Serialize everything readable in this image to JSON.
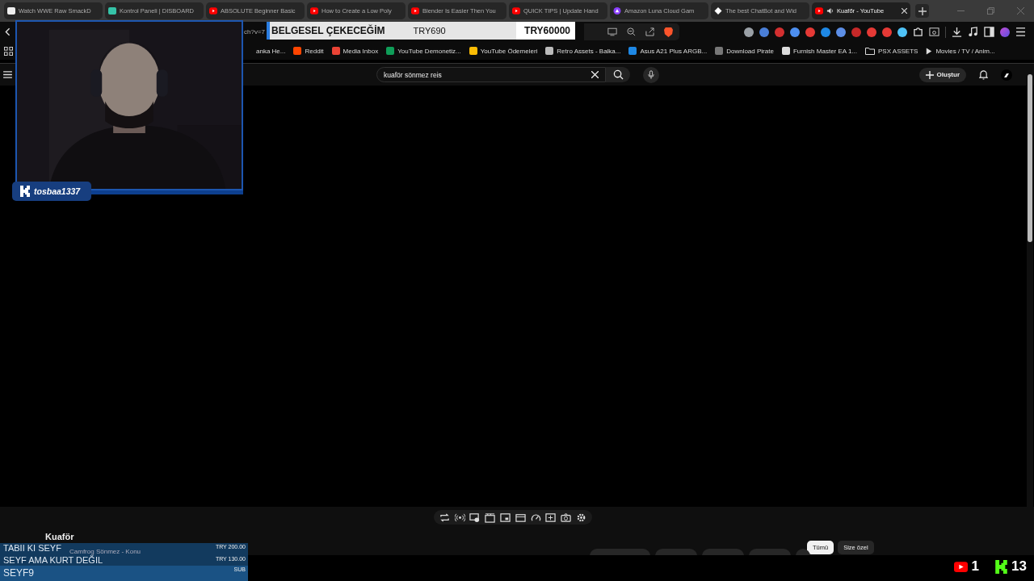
{
  "browser": {
    "tabs": [
      {
        "title": "Watch WWE Raw SmackD",
        "kind": "page",
        "audio": false,
        "selected": false
      },
      {
        "title": "Kontrol Paneli | DISBOARD",
        "kind": "board",
        "audio": false,
        "selected": false
      },
      {
        "title": "ABSOLUTE Beginner Basic",
        "kind": "youtube",
        "audio": false,
        "selected": false
      },
      {
        "title": "How to Create a Low Poly",
        "kind": "youtube",
        "audio": false,
        "selected": false
      },
      {
        "title": "Blender Is Easier Then You",
        "kind": "youtube",
        "audio": false,
        "selected": false
      },
      {
        "title": "QUICK TIPS | Update Hand",
        "kind": "youtube",
        "audio": false,
        "selected": false
      },
      {
        "title": "Amazon Luna Cloud Gam",
        "kind": "luna",
        "audio": false,
        "selected": false
      },
      {
        "title": "The best ChatBot and Wid",
        "kind": "diamond",
        "audio": false,
        "selected": false
      },
      {
        "title": "Kuafőr - YouTube",
        "kind": "youtube",
        "audio": true,
        "selected": true
      }
    ],
    "url_fragment": "ch?v=7",
    "extensions": [
      {
        "color": "#9aa0a6"
      },
      {
        "color": "#4a7fd8"
      },
      {
        "color": "#d32f2f"
      },
      {
        "color": "#4d8ff0"
      },
      {
        "color": "#e53935"
      },
      {
        "color": "#1e88e5"
      },
      {
        "color": "#5c8ee6"
      },
      {
        "color": "#c62828"
      },
      {
        "color": "#e53935"
      },
      {
        "color": "#e53935"
      },
      {
        "color": "#4fc3f7"
      }
    ],
    "bookmarks": [
      {
        "label": "anka He...",
        "kind": "none"
      },
      {
        "label": "Reddit",
        "kind": "reddit"
      },
      {
        "label": "Media Inbox",
        "kind": "mail"
      },
      {
        "label": "YouTube Demonetiz...",
        "kind": "sheet"
      },
      {
        "label": "YouTube Ödemeleri",
        "kind": "drive"
      },
      {
        "label": "Retro Assets - Balka...",
        "kind": "box"
      },
      {
        "label": "Asus A21 Plus ARGB...",
        "kind": "check"
      },
      {
        "label": "Download Pirate",
        "kind": "letter"
      },
      {
        "label": "Furnish Master EA 1...",
        "kind": "notion"
      },
      {
        "label": "PSX ASSETS",
        "kind": "folder"
      },
      {
        "label": "Movies / TV / Anim...",
        "kind": "play"
      }
    ]
  },
  "youtube": {
    "search": {
      "value": "kuaför sönmez reis"
    },
    "create_label": "Oluştur",
    "player_controls": [
      {
        "kind": "loop"
      },
      {
        "kind": "broadcast"
      },
      {
        "kind": "cast"
      },
      {
        "kind": "clapper"
      },
      {
        "kind": "pip"
      },
      {
        "kind": "window"
      },
      {
        "kind": "speed"
      },
      {
        "kind": "add"
      },
      {
        "kind": "camera"
      },
      {
        "kind": "gear"
      }
    ],
    "video_title": "Kuaför",
    "channel_name": "Camfrog Sönmez - Konu",
    "chips": [
      {
        "label": "Tümü",
        "selected": true
      },
      {
        "label": "Size özel",
        "selected": false
      }
    ]
  },
  "stream_overlay": {
    "username": "tosbaa1337",
    "title_bar": {
      "heading": "BELGESEL ÇEKECEĞİM",
      "goal": "TRY690",
      "target": "TRY60000"
    },
    "donations": [
      {
        "name": "TABII KI SEYF",
        "amount": "TRY 200.00"
      },
      {
        "name": "SEYF AMA KURT DEĞIL",
        "amount": "TRY 130.00"
      },
      {
        "name": "SEYF9",
        "amount": "SUB"
      }
    ],
    "counters": [
      {
        "kind": "youtube",
        "count": "1"
      },
      {
        "kind": "kick",
        "count": "13"
      }
    ]
  }
}
